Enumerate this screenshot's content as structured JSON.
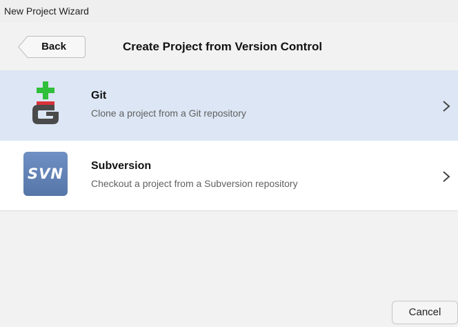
{
  "window": {
    "title": "New Project Wizard"
  },
  "header": {
    "back_label": "Back",
    "title": "Create Project from Version Control"
  },
  "options": [
    {
      "title": "Git",
      "description": "Clone a project from a Git repository",
      "icon": "git-icon",
      "selected": true
    },
    {
      "title": "Subversion",
      "description": "Checkout a project from a Subversion repository",
      "icon": "svn-icon",
      "icon_text": "SVN",
      "selected": false
    }
  ],
  "footer": {
    "cancel_label": "Cancel"
  },
  "colors": {
    "selected_row": "#dce6f4",
    "git_green": "#2fbf3a",
    "git_red": "#d9333b",
    "git_dark": "#4a4a4a",
    "svn_blue": "#6282b6"
  }
}
